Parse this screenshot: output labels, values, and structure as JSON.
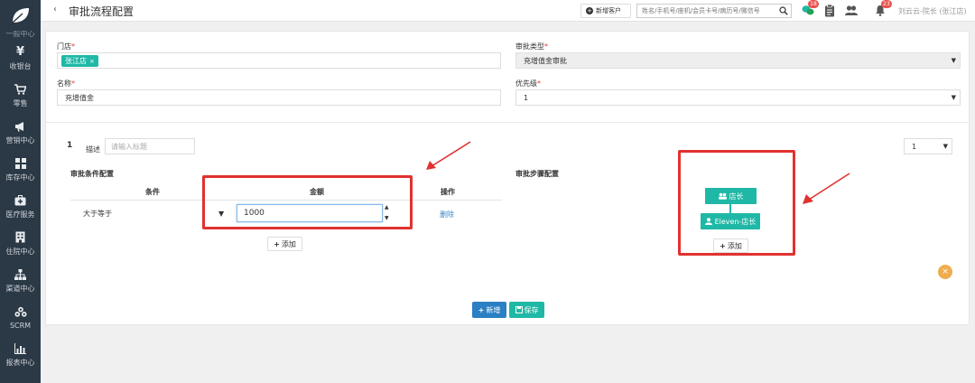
{
  "sidebar": {
    "cut_label": "一般中心",
    "items": [
      {
        "label": "收银台",
        "icon": "yen-icon"
      },
      {
        "label": "零售",
        "icon": "cart-icon"
      },
      {
        "label": "营销中心",
        "icon": "megaphone-icon"
      },
      {
        "label": "库存中心",
        "icon": "grid-icon"
      },
      {
        "label": "医疗服务",
        "icon": "medkit-icon"
      },
      {
        "label": "住院中心",
        "icon": "building-icon"
      },
      {
        "label": "渠道中心",
        "icon": "sitemap-icon"
      },
      {
        "label": "SCRM",
        "icon": "users-icon"
      },
      {
        "label": "报表中心",
        "icon": "chart-icon"
      }
    ]
  },
  "header": {
    "back": "‹",
    "title": "审批流程配置",
    "new_customer": "新增客户",
    "search_placeholder": "姓名/手机号/座机/会员卡号/病历号/微信号",
    "badge_chat": "18",
    "badge_bell": "23",
    "user": "刘云云-院长 (张江店)"
  },
  "form": {
    "store_label": "门店",
    "store_tag": "张江店",
    "approval_type_label": "审批类型",
    "approval_type_value": "充增值金审批",
    "name_label": "名称",
    "name_value": "充增值金",
    "priority_label": "优先级",
    "priority_value": "1"
  },
  "rule": {
    "index": "1",
    "desc_label": "描述",
    "desc_placeholder": "请输入标题",
    "page_select": "1"
  },
  "conditions": {
    "title": "审批条件配置",
    "col_condition": "条件",
    "col_amount": "金额",
    "col_action": "操作",
    "row": {
      "condition": "大于等于",
      "amount": "1000",
      "action": "删除"
    },
    "add_label": "添加"
  },
  "steps": {
    "title": "审批步骤配置",
    "nodes": [
      "店长",
      "Eleven-店长"
    ],
    "add_label": "添加"
  },
  "footer": {
    "new_label": "新增",
    "save_label": "保存"
  },
  "colors": {
    "accent": "#1fb8a6",
    "primary": "#2b7fc3",
    "highlight": "#e1322f",
    "sidebar": "#2b3845"
  }
}
